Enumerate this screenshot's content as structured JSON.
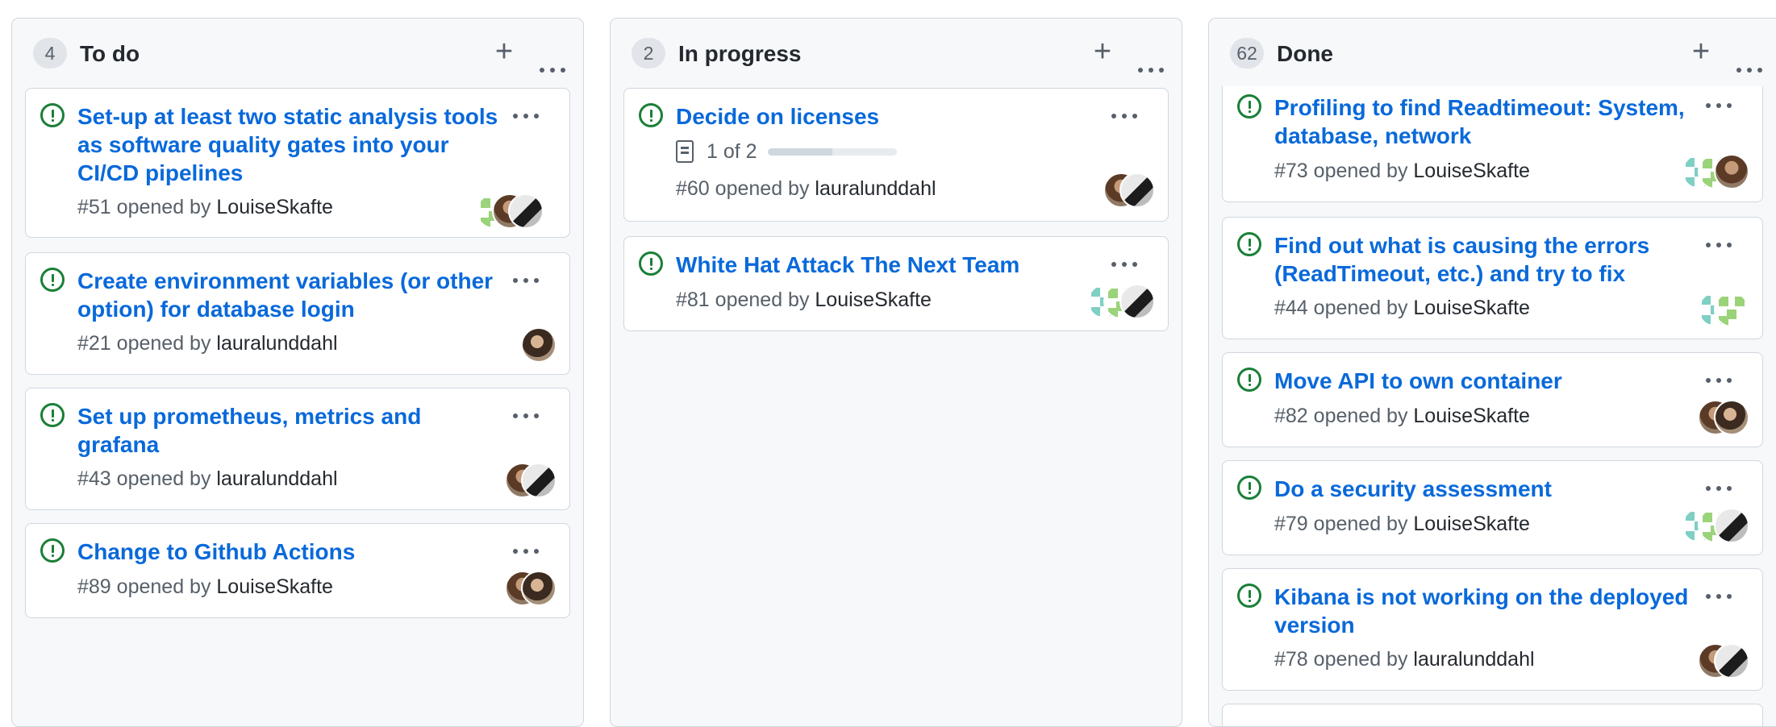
{
  "columns": [
    {
      "count": "4",
      "title": "To do",
      "cards": [
        {
          "title": "Set-up at least two static analysis tools as software quality gates into your CI/CD pipelines",
          "number": "#51",
          "opened_by": "opened by",
          "user": "LouiseSkafte"
        },
        {
          "title": "Create environment variables (or other option) for database login",
          "number": "#21",
          "opened_by": "opened by",
          "user": "lauralunddahl"
        },
        {
          "title": "Set up prometheus, metrics and grafana",
          "number": "#43",
          "opened_by": "opened by",
          "user": "lauralunddahl"
        },
        {
          "title": "Change to Github Actions",
          "number": "#89",
          "opened_by": "opened by",
          "user": "LouiseSkafte"
        }
      ]
    },
    {
      "count": "2",
      "title": "In progress",
      "cards": [
        {
          "title": "Decide on licenses",
          "checklist": "1 of 2",
          "checklist_progress": 0.5,
          "number": "#60",
          "opened_by": "opened by",
          "user": "lauralunddahl"
        },
        {
          "title": "White Hat Attack The Next Team",
          "number": "#81",
          "opened_by": "opened by",
          "user": "LouiseSkafte"
        }
      ]
    },
    {
      "count": "62",
      "title": "Done",
      "cards": [
        {
          "title": "Profiling to find Readtimeout: System, database, network",
          "number": "#73",
          "opened_by": "opened by",
          "user": "LouiseSkafte"
        },
        {
          "title": "Find out what is causing the errors (ReadTimeout, etc.) and try to fix",
          "number": "#44",
          "opened_by": "opened by",
          "user": "LouiseSkafte"
        },
        {
          "title": "Move API to own container",
          "number": "#82",
          "opened_by": "opened by",
          "user": "LouiseSkafte"
        },
        {
          "title": "Do a security assessment",
          "number": "#79",
          "opened_by": "opened by",
          "user": "LouiseSkafte"
        },
        {
          "title": "Kibana is not working on the deployed version",
          "number": "#78",
          "opened_by": "opened by",
          "user": "lauralunddahl"
        }
      ]
    }
  ],
  "colors": {
    "link": "#0969da",
    "open_issue": "#1a7f37",
    "column_bg": "#f6f8fa",
    "border": "#d0d7de"
  },
  "icons": {
    "add": "plus-icon",
    "more": "kebab-horizontal-icon",
    "issue": "issue-opened-icon",
    "checklist": "checklist-icon"
  }
}
